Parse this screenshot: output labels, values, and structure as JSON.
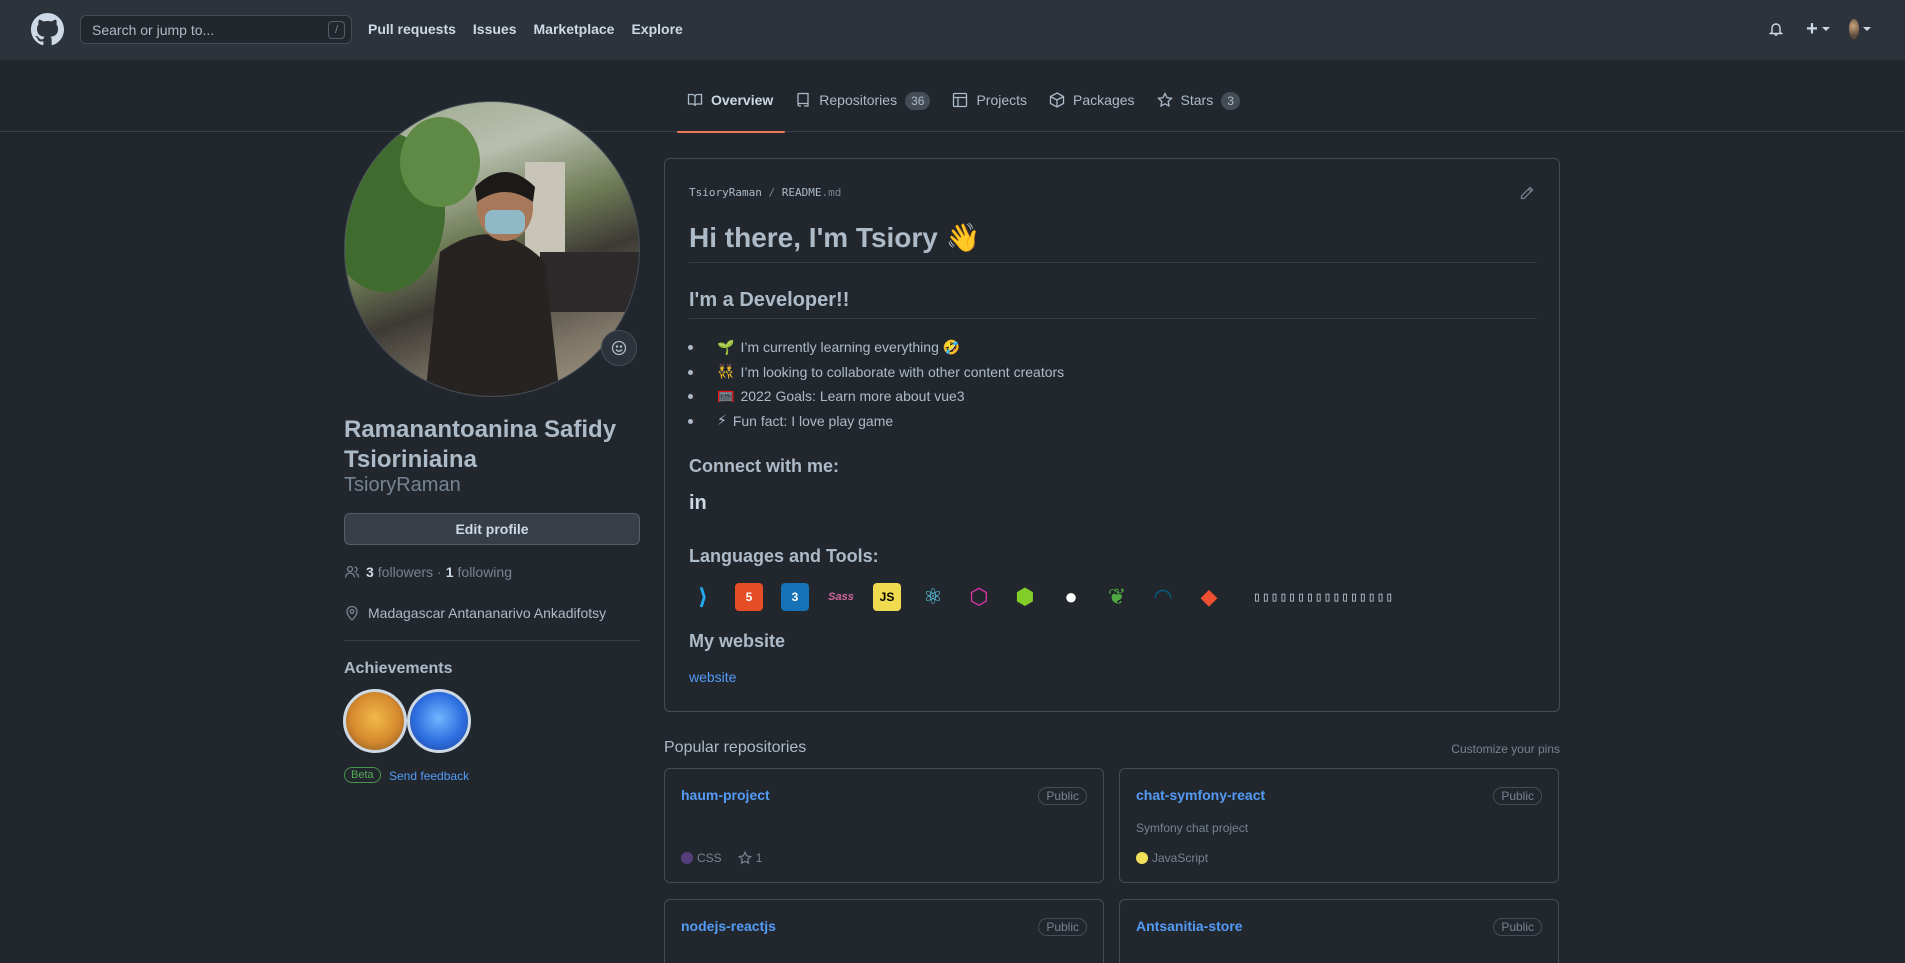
{
  "header": {
    "search_placeholder": "Search or jump to...",
    "search_shortcut": "/",
    "nav": [
      "Pull requests",
      "Issues",
      "Marketplace",
      "Explore"
    ],
    "plus_label": "+"
  },
  "tabs": [
    {
      "label": "Overview",
      "icon": "book-icon",
      "active": true
    },
    {
      "label": "Repositories",
      "icon": "repo-icon",
      "count": "36"
    },
    {
      "label": "Projects",
      "icon": "table-icon"
    },
    {
      "label": "Packages",
      "icon": "package-icon"
    },
    {
      "label": "Stars",
      "icon": "star-icon",
      "count": "3"
    }
  ],
  "profile": {
    "fullname": "Ramanantoanina Safidy Tsioriniaina",
    "username": "TsioryRaman",
    "edit_label": "Edit profile",
    "followers_count": "3",
    "followers_label": "followers",
    "following_count": "1",
    "following_label": "following",
    "location": "Madagascar Antananarivo Ankadifotsy",
    "achievements_title": "Achievements",
    "beta_label": "Beta",
    "feedback_label": "Send feedback"
  },
  "readme": {
    "path_user": "TsioryRaman",
    "path_sep": "/",
    "path_file": "README",
    "path_ext": ".md",
    "h1": "Hi there, I'm Tsiory 👋",
    "h2": "I'm a Developer!!",
    "bullets": [
      {
        "emoji": "🌱",
        "text": "I’m currently learning everything 🤣"
      },
      {
        "emoji": "👯",
        "text": "I’m looking to collaborate with other content creators"
      },
      {
        "emoji": "🥅",
        "text": "2022 Goals: Learn more about vue3"
      },
      {
        "emoji": "⚡",
        "text": "Fun fact: I love play game"
      }
    ],
    "connect_title": "Connect with me:",
    "linkedin_icon": "in",
    "tools_title": "Languages and Tools:",
    "tools": [
      {
        "icon": "vscode-icon",
        "glyph": "⟩",
        "color": "#23a9f2",
        "bg": "transparent"
      },
      {
        "icon": "html5-icon",
        "glyph": "5",
        "color": "#ffffff",
        "bg": "#e44d26"
      },
      {
        "icon": "css3-icon",
        "glyph": "3",
        "color": "#ffffff",
        "bg": "#1572b6"
      },
      {
        "icon": "sass-icon",
        "glyph": "Sass",
        "color": "#cd6799",
        "bg": "transparent"
      },
      {
        "icon": "javascript-icon",
        "glyph": "JS",
        "color": "#000000",
        "bg": "#f0db4f"
      },
      {
        "icon": "react-icon",
        "glyph": "⚛",
        "color": "#61dafb",
        "bg": "transparent"
      },
      {
        "icon": "graphql-icon",
        "glyph": "⬡",
        "color": "#e535ab",
        "bg": "transparent"
      },
      {
        "icon": "nodejs-icon",
        "glyph": "⬢",
        "color": "#83cd29",
        "bg": "transparent"
      },
      {
        "icon": "deno-icon",
        "glyph": "●",
        "color": "#ffffff",
        "bg": "transparent"
      },
      {
        "icon": "mongodb-icon",
        "glyph": "❦",
        "color": "#4faa41",
        "bg": "transparent"
      },
      {
        "icon": "mysql-icon",
        "glyph": "◠",
        "color": "#00618a",
        "bg": "transparent"
      },
      {
        "icon": "git-icon",
        "glyph": "◆",
        "color": "#f05032",
        "bg": "transparent"
      }
    ],
    "missing_glyphs": "▯▯▯▯▯▯▯▯▯▯▯▯▯▯▯▯",
    "website_title": "My website",
    "website_link": "website"
  },
  "popular": {
    "title": "Popular repositories",
    "customize": "Customize your pins",
    "repos": [
      {
        "name": "haum-project",
        "visibility": "Public",
        "desc": "",
        "lang": "CSS",
        "lang_color": "#563d7c",
        "stars": "1"
      },
      {
        "name": "chat-symfony-react",
        "visibility": "Public",
        "desc": "Symfony chat project",
        "lang": "JavaScript",
        "lang_color": "#f1e05a",
        "stars": ""
      },
      {
        "name": "nodejs-reactjs",
        "visibility": "Public",
        "desc": "",
        "lang": "",
        "lang_color": "",
        "stars": ""
      },
      {
        "name": "Antsanitia-store",
        "visibility": "Public",
        "desc": "",
        "lang": "",
        "lang_color": "",
        "stars": ""
      }
    ]
  }
}
